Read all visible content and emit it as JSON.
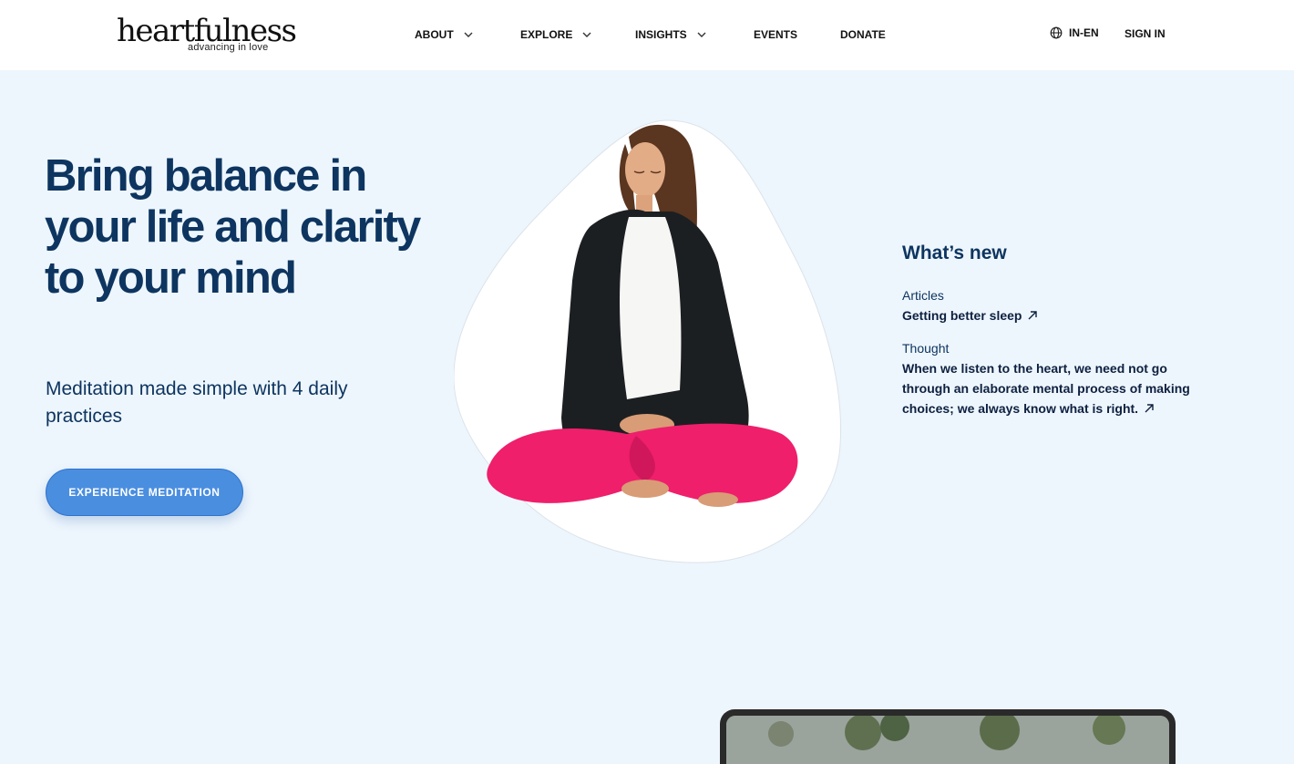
{
  "brand": {
    "logo_word": "heartfulness",
    "logo_tagline": "advancing in love"
  },
  "nav": {
    "items": [
      {
        "label": "ABOUT",
        "has_dropdown": true
      },
      {
        "label": "EXPLORE",
        "has_dropdown": true
      },
      {
        "label": "INSIGHTS",
        "has_dropdown": true
      },
      {
        "label": "EVENTS",
        "has_dropdown": false
      },
      {
        "label": "DONATE",
        "has_dropdown": false
      }
    ],
    "language": "IN-EN",
    "language_icon": "globe-icon",
    "sign_in": "SIGN IN"
  },
  "hero": {
    "title": "Bring balance in your life and clarity to your mind",
    "subtitle": "Meditation made simple with 4 daily practices",
    "cta_label": "EXPERIENCE MEDITATION"
  },
  "whats_new": {
    "title": "What’s new",
    "entries": [
      {
        "category": "Articles",
        "link_text": "Getting better sleep",
        "icon": "arrow-up-right-icon"
      },
      {
        "category": "Thought",
        "link_text": "When we listen to the heart, we need not go through an elaborate mental process of making choices; we always know what is right.",
        "icon": "arrow-up-right-icon"
      }
    ]
  },
  "colors": {
    "page_bg": "#eef6fd",
    "heading": "#0d3560",
    "cta_bg": "#4a8ee0",
    "header_bg": "#ffffff"
  }
}
